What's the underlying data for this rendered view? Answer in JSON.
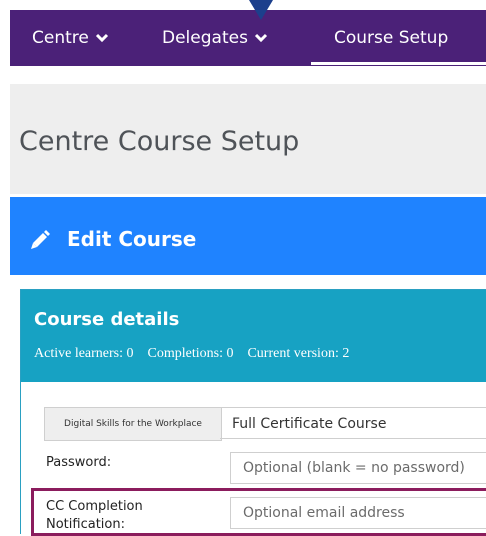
{
  "nav": {
    "items": [
      {
        "label": "Centre"
      },
      {
        "label": "Delegates"
      },
      {
        "label": "Course Setup"
      }
    ]
  },
  "page": {
    "title": "Centre Course Setup"
  },
  "edit_section": {
    "title": "Edit Course",
    "icon": "pencil-icon"
  },
  "course_details": {
    "title": "Course details",
    "active_learners": "Active learners: 0",
    "completions": "Completions: 0",
    "current_version": "Current version: 2"
  },
  "form": {
    "course_group_label": "Digital Skills for the Workplace",
    "course_group_value": "Full Certificate Course",
    "password_label": "Password:",
    "password_placeholder": "Optional (blank = no password)",
    "cc_label_line1": "CC Completion",
    "cc_label_line2": "Notification:",
    "cc_placeholder": "Optional email address"
  },
  "colors": {
    "nav_bg": "#4b2178",
    "edit_bar": "#1f83ff",
    "card_header": "#17a2c3",
    "highlight": "#8b1c5d"
  }
}
